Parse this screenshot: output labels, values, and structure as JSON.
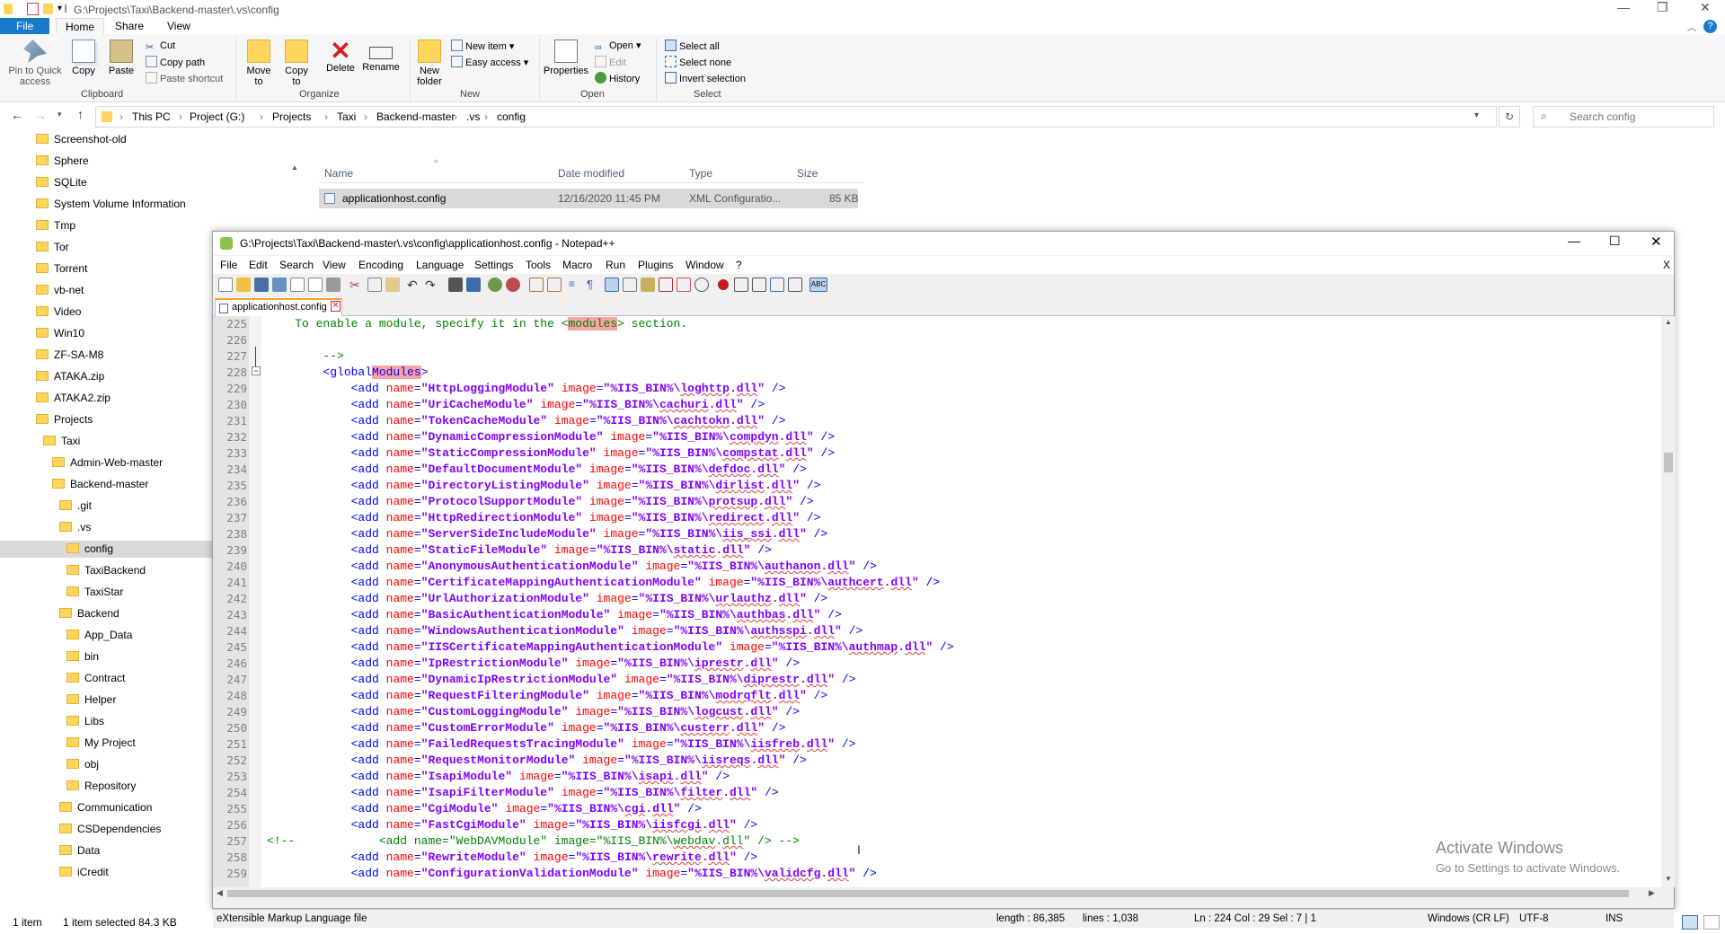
{
  "explorer": {
    "title_path": "G:\\Projects\\Taxi\\Backend-master\\.vs\\config",
    "tabs": [
      "File",
      "Home",
      "Share",
      "View"
    ],
    "clipboard": {
      "pin": "Pin to Quick access",
      "copy": "Copy",
      "paste": "Paste",
      "cut": "Cut",
      "copy_path": "Copy path",
      "paste_shortcut": "Paste shortcut",
      "group": "Clipboard"
    },
    "organize": {
      "move_to": "Move to",
      "copy_to": "Copy to",
      "delete": "Delete",
      "rename": "Rename",
      "group": "Organize"
    },
    "new": {
      "new_folder": "New folder",
      "new_item": "New item",
      "easy_access": "Easy access",
      "group": "New"
    },
    "open": {
      "properties": "Properties",
      "open": "Open",
      "edit": "Edit",
      "history": "History",
      "group": "Open"
    },
    "select": {
      "select_all": "Select all",
      "select_none": "Select none",
      "invert": "Invert selection",
      "group": "Select"
    },
    "breadcrumb": [
      "This PC",
      "Project (G:)",
      "Projects",
      "Taxi",
      "Backend-master",
      ".vs",
      "config"
    ],
    "search_placeholder": "Search config",
    "columns": {
      "name": "Name",
      "date": "Date modified",
      "type": "Type",
      "size": "Size"
    },
    "file": {
      "name": "applicationhost.config",
      "date": "12/16/2020 11:45 PM",
      "type": "XML Configuratio...",
      "size": "85 KB"
    },
    "nav_items": [
      {
        "label": "Screenshot-old",
        "indent": 0
      },
      {
        "label": "Sphere",
        "indent": 0
      },
      {
        "label": "SQLite",
        "indent": 0
      },
      {
        "label": "System Volume Information",
        "indent": 0
      },
      {
        "label": "Tmp",
        "indent": 0
      },
      {
        "label": "Tor",
        "indent": 0
      },
      {
        "label": "Torrent",
        "indent": 0
      },
      {
        "label": "vb-net",
        "indent": 0
      },
      {
        "label": "Video",
        "indent": 0
      },
      {
        "label": "Win10",
        "indent": 0
      },
      {
        "label": "ZF-SA-M8",
        "indent": 0
      },
      {
        "label": "ATAKA.zip",
        "indent": 0
      },
      {
        "label": "ATAKA2.zip",
        "indent": 0
      },
      {
        "label": "Projects",
        "indent": 0
      },
      {
        "label": "Taxi",
        "indent": 1
      },
      {
        "label": "Admin-Web-master",
        "indent": 2
      },
      {
        "label": "Backend-master",
        "indent": 2
      },
      {
        "label": ".git",
        "indent": 3
      },
      {
        "label": ".vs",
        "indent": 3
      },
      {
        "label": "config",
        "indent": 4
      },
      {
        "label": "TaxiBackend",
        "indent": 4
      },
      {
        "label": "TaxiStar",
        "indent": 4
      },
      {
        "label": "Backend",
        "indent": 3
      },
      {
        "label": "App_Data",
        "indent": 4
      },
      {
        "label": "bin",
        "indent": 4
      },
      {
        "label": "Contract",
        "indent": 4
      },
      {
        "label": "Helper",
        "indent": 4
      },
      {
        "label": "Libs",
        "indent": 4
      },
      {
        "label": "My Project",
        "indent": 4
      },
      {
        "label": "obj",
        "indent": 4
      },
      {
        "label": "Repository",
        "indent": 4
      },
      {
        "label": "Communication",
        "indent": 3
      },
      {
        "label": "CSDependencies",
        "indent": 3
      },
      {
        "label": "Data",
        "indent": 3
      },
      {
        "label": "iCredit",
        "indent": 3
      }
    ],
    "status": {
      "count": "1 item",
      "selected": "1 item selected  84.3 KB"
    }
  },
  "npp": {
    "title": "G:\\Projects\\Taxi\\Backend-master\\.vs\\config\\applicationhost.config - Notepad++",
    "menu": [
      "File",
      "Edit",
      "Search",
      "View",
      "Encoding",
      "Language",
      "Settings",
      "Tools",
      "Macro",
      "Run",
      "Plugins",
      "Window",
      "?"
    ],
    "tab": "applicationhost.config",
    "intro_line": {
      "num": "225",
      "a": "    To enable a module, specify it in the <",
      "b": "modules",
      "c": "> section."
    },
    "blank_line": "226",
    "comment_close": {
      "num": "227",
      "text": "-->"
    },
    "global_open": {
      "num": "228",
      "a": "<global",
      "b": "Modules",
      "c": ">"
    },
    "modules": [
      {
        "num": "229",
        "name": "HttpLoggingModule",
        "image": "%IIS_BIN%\\loghttp.dll"
      },
      {
        "num": "230",
        "name": "UriCacheModule",
        "image": "%IIS_BIN%\\cachuri.dll"
      },
      {
        "num": "231",
        "name": "TokenCacheModule",
        "image": "%IIS_BIN%\\cachtokn.dll"
      },
      {
        "num": "232",
        "name": "DynamicCompressionModule",
        "image": "%IIS_BIN%\\compdyn.dll"
      },
      {
        "num": "233",
        "name": "StaticCompressionModule",
        "image": "%IIS_BIN%\\compstat.dll"
      },
      {
        "num": "234",
        "name": "DefaultDocumentModule",
        "image": "%IIS_BIN%\\defdoc.dll"
      },
      {
        "num": "235",
        "name": "DirectoryListingModule",
        "image": "%IIS_BIN%\\dirlist.dll"
      },
      {
        "num": "236",
        "name": "ProtocolSupportModule",
        "image": "%IIS_BIN%\\protsup.dll"
      },
      {
        "num": "237",
        "name": "HttpRedirectionModule",
        "image": "%IIS_BIN%\\redirect.dll"
      },
      {
        "num": "238",
        "name": "ServerSideIncludeModule",
        "image": "%IIS_BIN%\\iis_ssi.dll"
      },
      {
        "num": "239",
        "name": "StaticFileModule",
        "image": "%IIS_BIN%\\static.dll"
      },
      {
        "num": "240",
        "name": "AnonymousAuthenticationModule",
        "image": "%IIS_BIN%\\authanon.dll"
      },
      {
        "num": "241",
        "name": "CertificateMappingAuthenticationModule",
        "image": "%IIS_BIN%\\authcert.dll"
      },
      {
        "num": "242",
        "name": "UrlAuthorizationModule",
        "image": "%IIS_BIN%\\urlauthz.dll"
      },
      {
        "num": "243",
        "name": "BasicAuthenticationModule",
        "image": "%IIS_BIN%\\authbas.dll"
      },
      {
        "num": "244",
        "name": "WindowsAuthenticationModule",
        "image": "%IIS_BIN%\\authsspi.dll"
      },
      {
        "num": "245",
        "name": "IISCertificateMappingAuthenticationModule",
        "image": "%IIS_BIN%\\authmap.dll"
      },
      {
        "num": "246",
        "name": "IpRestrictionModule",
        "image": "%IIS_BIN%\\iprestr.dll"
      },
      {
        "num": "247",
        "name": "DynamicIpRestrictionModule",
        "image": "%IIS_BIN%\\diprestr.dll"
      },
      {
        "num": "248",
        "name": "RequestFilteringModule",
        "image": "%IIS_BIN%\\modrqflt.dll"
      },
      {
        "num": "249",
        "name": "CustomLoggingModule",
        "image": "%IIS_BIN%\\logcust.dll"
      },
      {
        "num": "250",
        "name": "CustomErrorModule",
        "image": "%IIS_BIN%\\custerr.dll"
      },
      {
        "num": "251",
        "name": "FailedRequestsTracingModule",
        "image": "%IIS_BIN%\\iisfreb.dll"
      },
      {
        "num": "252",
        "name": "RequestMonitorModule",
        "image": "%IIS_BIN%\\iisreqs.dll"
      },
      {
        "num": "253",
        "name": "IsapiModule",
        "image": "%IIS_BIN%\\isapi.dll"
      },
      {
        "num": "254",
        "name": "IsapiFilterModule",
        "image": "%IIS_BIN%\\filter.dll"
      },
      {
        "num": "255",
        "name": "CgiModule",
        "image": "%IIS_BIN%\\cgi.dll"
      },
      {
        "num": "256",
        "name": "FastCgiModule",
        "image": "%IIS_BIN%\\iisfcgi.dll"
      },
      {
        "num": "257",
        "name": "WebDAVModule",
        "image": "%IIS_BIN%\\webdav.dll",
        "commented": true
      },
      {
        "num": "258",
        "name": "RewriteModule",
        "image": "%IIS_BIN%\\rewrite.dll"
      },
      {
        "num": "259",
        "name": "ConfigurationValidationModule",
        "image": "%IIS_BIN%\\validcfg.dll"
      }
    ],
    "status": {
      "type": "eXtensible Markup Language file",
      "length": "length : 86,385",
      "lines": "lines : 1,038",
      "pos": "Ln : 224    Col : 29    Sel : 7 | 1",
      "eol": "Windows (CR LF)",
      "enc": "UTF-8",
      "ins": "INS"
    }
  },
  "watermark": {
    "title": "Activate Windows",
    "sub": "Go to Settings to activate Windows."
  }
}
